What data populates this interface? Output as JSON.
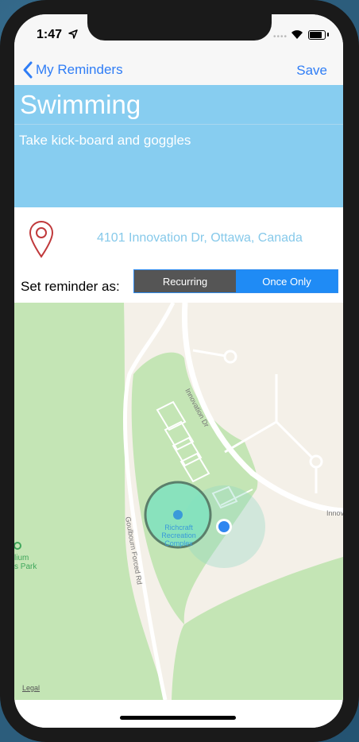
{
  "status_bar": {
    "time": "1:47"
  },
  "nav": {
    "back_label": "My Reminders",
    "save_label": "Save"
  },
  "reminder": {
    "title": "Swimming",
    "notes": "Take kick-board and goggles",
    "address": "4101 Innovation Dr, Ottawa, Canada"
  },
  "reminder_type": {
    "label": "Set reminder as:",
    "options": [
      "Recurring",
      "Once Only"
    ],
    "selected": "Once Only"
  },
  "map": {
    "labels": {
      "innovation_dr": "Innovation Dr",
      "innov_edge": "Innov",
      "goulbourn": "Goulbourn Forced Rd",
      "poi_line1": "Richcraft",
      "poi_line2": "Recreation",
      "poi_line3": "Complex",
      "park_line1": "lium",
      "park_line2": "s Park"
    },
    "legal": "Legal",
    "colors": {
      "park": "#c4e5b5",
      "land": "#f4f0e8",
      "road": "#ffffff",
      "user_dot": "#2f86f0"
    }
  }
}
